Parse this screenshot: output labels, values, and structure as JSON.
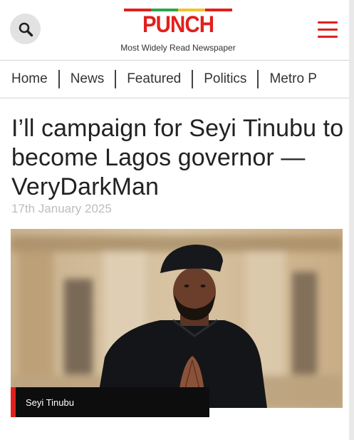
{
  "header": {
    "logo_text": "PUNCH",
    "tagline": "Most Widely Read Newspaper",
    "logo_bar_colors": [
      "#e0201d",
      "#2ea44f",
      "#f2c12e",
      "#e0201d",
      "#2ea44f"
    ],
    "search_icon": "search-icon",
    "menu_icon": "hamburger-menu-icon",
    "accent_color": "#e0201d"
  },
  "nav": {
    "items": [
      "Home",
      "News",
      "Featured",
      "Politics",
      "Metro P"
    ]
  },
  "article": {
    "title": "I’ll campaign for Seyi Tinubu to become Lagos governor — VeryDarkMan",
    "date": "17th January 2025",
    "image_caption": "Seyi Tinubu"
  }
}
